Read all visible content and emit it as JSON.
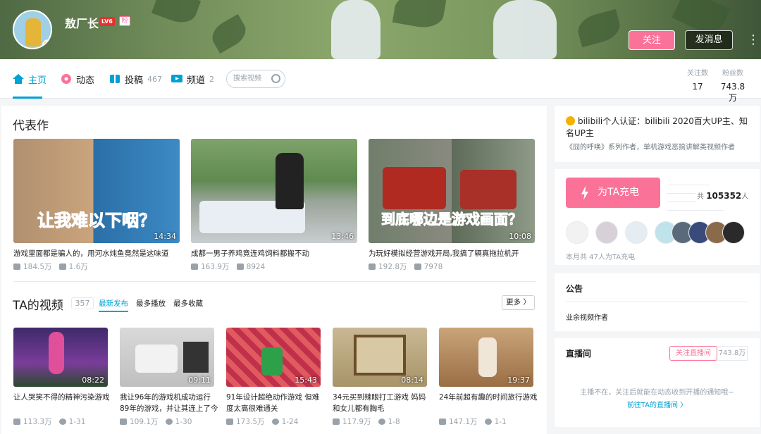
{
  "profile": {
    "username": "敖厂长",
    "level_badge": "LV6",
    "fan_badge": "粉"
  },
  "header_actions": {
    "follow_label": "关注",
    "message_label": "发消息",
    "more_label": "⋮"
  },
  "nav": {
    "items": [
      {
        "label": "主页",
        "count": "",
        "icon": "home-icon"
      },
      {
        "label": "动态",
        "count": "",
        "icon": "flower-icon"
      },
      {
        "label": "投稿",
        "count": "467",
        "icon": "cube-icon"
      },
      {
        "label": "频道",
        "count": "2",
        "icon": "channel-icon"
      }
    ],
    "search_placeholder": "搜索视频"
  },
  "stats": [
    {
      "label": "关注数",
      "value": "17"
    },
    {
      "label": "粉丝数",
      "value": "743.8万"
    }
  ],
  "masterpiece": {
    "title": "代表作",
    "videos": [
      {
        "title": "游戏里面都是骗人的，用河水炖鱼竟然是这味道",
        "duration": "14:34",
        "plays": "184.5万",
        "danmaku": "1.6万",
        "overlay": "让我难以下咽？"
      },
      {
        "title": "成都一男子养鸡竟连鸡饲料都搬不动",
        "duration": "13:46",
        "plays": "163.9万",
        "danmaku": "8924",
        "overlay": ""
      },
      {
        "title": "为玩好模拟经营游戏开局,我搞了辆真拖拉机开",
        "duration": "10:08",
        "plays": "192.8万",
        "danmaku": "7978",
        "overlay": "到底哪边是游戏画面？"
      }
    ]
  },
  "videos": {
    "title": "TA的视频",
    "count": "357",
    "tabs": [
      "最新发布",
      "最多播放",
      "最多收藏"
    ],
    "more_label": "更多 〉",
    "items": [
      {
        "title1": "让人哭笑不得的精神污染游戏",
        "title2": "",
        "duration": "08:22",
        "plays": "113.3万",
        "date": "1-31"
      },
      {
        "title1": "我让96年的游戏机成功运行",
        "title2": "89年的游戏，并让其连上了今",
        "duration": "09:11",
        "plays": "109.1万",
        "date": "1-30"
      },
      {
        "title1": "91年设计超绝动作游戏 但难",
        "title2": "度太高很难通关",
        "duration": "15:43",
        "plays": "173.5万",
        "date": "1-24"
      },
      {
        "title1": "34元买到辣眼打工游戏 妈妈",
        "title2": "和女儿都有胸毛",
        "duration": "08:14",
        "plays": "117.9万",
        "date": "1-8"
      },
      {
        "title1": "24年前超有趣的时间旅行游戏",
        "title2": "",
        "duration": "19:37",
        "plays": "147.1万",
        "date": "1-1"
      }
    ]
  },
  "certification": {
    "line1": "bilibili个人认证：bilibili 2020百大UP主、知名UP主",
    "line2": "《囧的呼唤》系列作者，单机游戏恶搞讲解类视频作者"
  },
  "charge": {
    "button_label": "为TA充电",
    "total_prefix": "共",
    "total_value": "105352",
    "total_suffix": "人",
    "month_note": "本月共 47人为TA充电"
  },
  "notice": {
    "title": "公告",
    "text": "业余视频作者"
  },
  "live": {
    "title": "直播间",
    "follow_live_label": "关注直播间",
    "count": "743.8万",
    "note": "主播不在，关注后就能在动态收到开播的通知哦~",
    "link": "前往TA的直播间  〉"
  }
}
